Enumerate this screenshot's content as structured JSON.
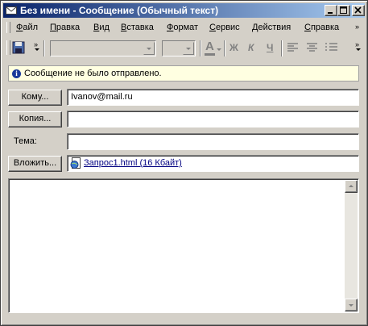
{
  "window": {
    "title": "Без имени - Сообщение (Обычный текст)"
  },
  "menu": {
    "items": [
      {
        "label": "Файл",
        "accel": "Ф",
        "rest": "айл"
      },
      {
        "label": "Правка",
        "accel": "П",
        "rest": "равка"
      },
      {
        "label": "Вид",
        "accel": "В",
        "rest": "ид"
      },
      {
        "label": "Вставка",
        "accel": "В",
        "rest": "ставка"
      },
      {
        "label": "Формат",
        "accel": "Ф",
        "rest": "ормат"
      },
      {
        "label": "Сервис",
        "accel": "С",
        "rest": "ервис"
      },
      {
        "label": "Действия",
        "accel": "Д",
        "rest": "ействия"
      },
      {
        "label": "Справка",
        "accel": "С",
        "rest": "правка"
      }
    ]
  },
  "toolbar": {
    "font_color_glyph": "A",
    "bold_glyph": "Ж",
    "italic_glyph": "К",
    "underline_glyph": "Ч"
  },
  "infobar": {
    "text": "Сообщение не было отправлено."
  },
  "fields": {
    "to_button": "Кому...",
    "to_value": "Ivanov@mail.ru",
    "cc_button": "Копия...",
    "cc_value": "",
    "subject_label": "Тема:",
    "subject_value": "",
    "attach_button": "Вложить...",
    "attachment": "Запрос1.html (16 Кбайт)"
  },
  "colors": {
    "title_start": "#0a246a",
    "title_end": "#a6caf0",
    "face": "#d4d0c8",
    "info_bg": "#ffffe1"
  }
}
